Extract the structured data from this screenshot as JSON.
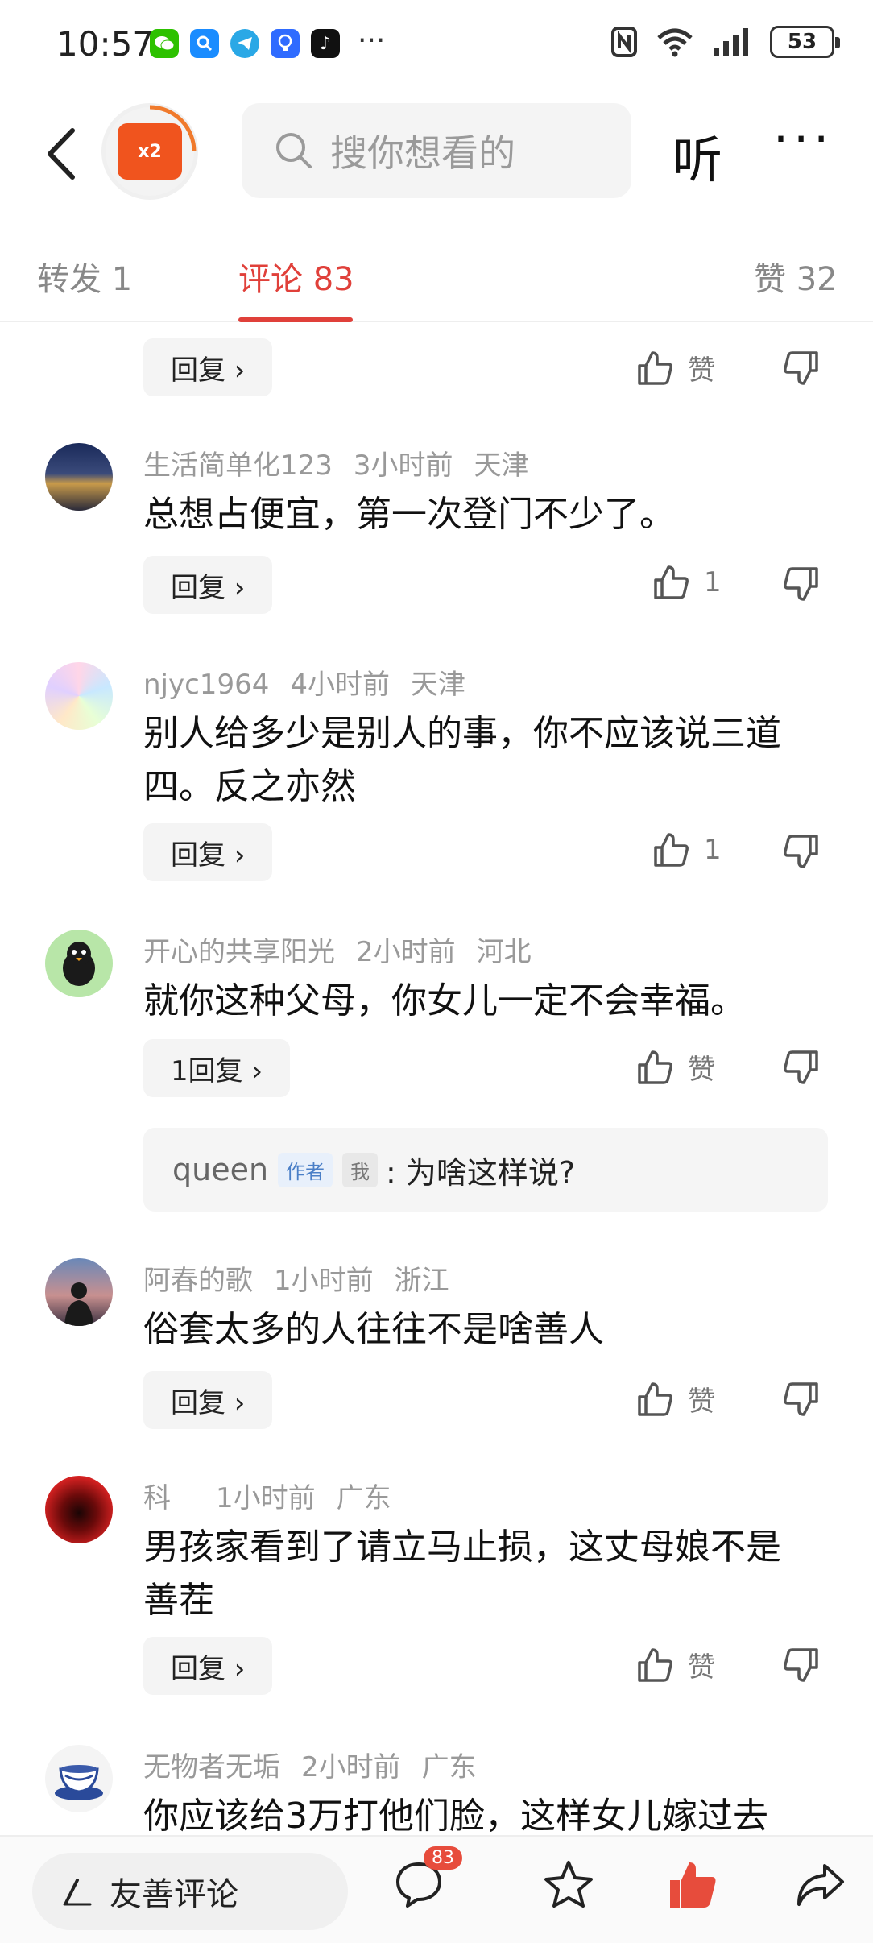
{
  "status_bar": {
    "time": "10:57",
    "battery": "53",
    "more": "···",
    "tiktok_label": "♪"
  },
  "nav": {
    "avatar_badge": "x2",
    "search_placeholder": "搜你想看的",
    "listen_label": "听",
    "more_label": "···"
  },
  "tabs": [
    {
      "label": "转发 1"
    },
    {
      "label": "评论 83"
    },
    {
      "label": "赞 32"
    }
  ],
  "top_partial": {
    "reply_label": "回复 ›",
    "like_label": "赞"
  },
  "comments": [
    {
      "user": "生活简单化123",
      "time": "3小时前",
      "location": "天津",
      "text": "总想占便宜，第一次登门不少了。",
      "reply_label": "回复 ›",
      "like_label": "1"
    },
    {
      "user": "njyc1964",
      "time": "4小时前",
      "location": "天津",
      "text": "别人给多少是别人的事，你不应该说三道四。反之亦然",
      "reply_label": "回复 ›",
      "like_label": "1"
    },
    {
      "user": "开心的共享阳光",
      "time": "2小时前",
      "location": "河北",
      "text": "就你这种父母，你女儿一定不会幸福。",
      "reply_label": "1回复 ›",
      "like_label": "赞"
    },
    {
      "user": "阿春的歌",
      "time": "1小时前",
      "location": "浙江",
      "text": "俗套太多的人往往不是啥善人",
      "reply_label": "回复 ›",
      "like_label": "赞"
    },
    {
      "user": "科",
      "time": "1小时前",
      "location": "广东",
      "text": "男孩家看到了请立马止损，这丈母娘不是善茬",
      "reply_label": "回复 ›",
      "like_label": "赞"
    },
    {
      "user": "无物者无垢",
      "time": "2小时前",
      "location": "广东",
      "text": "你应该给3万打他们脸，这样女儿嫁过去"
    }
  ],
  "sub_reply": {
    "user": "queen",
    "author_tag": "作者",
    "me_tag": "我",
    "text": ": 为啥这样说?"
  },
  "bottom_bar": {
    "input_label": "友善评论",
    "comment_count": "83"
  },
  "colors": {
    "accent": "#e0403a",
    "like_red": "#e74c3c"
  }
}
